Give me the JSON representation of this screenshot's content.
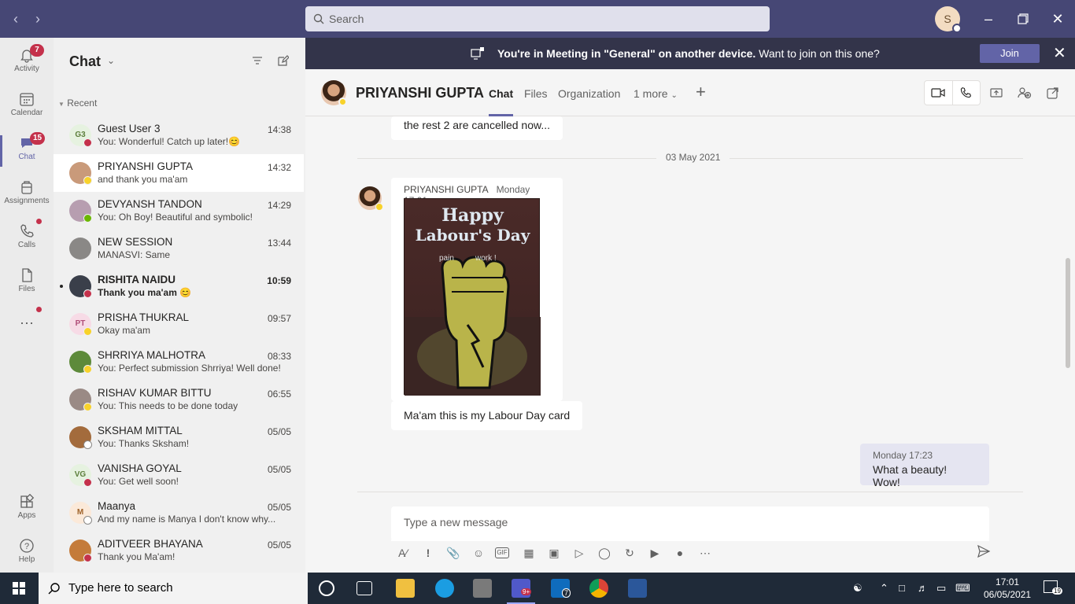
{
  "titlebar": {
    "search_placeholder": "Search",
    "me_initial": "S"
  },
  "rail": [
    {
      "label": "Activity",
      "badge": "7"
    },
    {
      "label": "Calendar"
    },
    {
      "label": "Chat",
      "badge": "15"
    },
    {
      "label": "Assignments"
    },
    {
      "label": "Calls"
    },
    {
      "label": "Files"
    },
    {
      "label": "Apps"
    },
    {
      "label": "Help"
    }
  ],
  "chatlist": {
    "title": "Chat",
    "section": "Recent",
    "items": [
      {
        "initials": "G3",
        "name": "Guest User 3",
        "preview": "You: Wonderful! Catch up later!😊",
        "time": "14:38",
        "avatar_bg": "#e6f2e0",
        "avatar_fg": "#5b7e3a",
        "status": "#c4314b"
      },
      {
        "initials": "",
        "name": "PRIYANSHI GUPTA",
        "preview": "and thank you ma'am",
        "time": "14:32",
        "avatar_bg": "#c99a7a",
        "avatar_fg": "#fff",
        "status": "#f8d22a"
      },
      {
        "initials": "",
        "name": "DEVYANSH TANDON",
        "preview": "You: Oh Boy! Beautiful and symbolic!",
        "time": "14:29",
        "avatar_bg": "#b79eb0",
        "avatar_fg": "#fff",
        "status": "#6bb700"
      },
      {
        "initials": "",
        "name": "NEW SESSION",
        "preview": "MANASVI: Same",
        "time": "13:44",
        "avatar_bg": "#8a8886",
        "avatar_fg": "#fff",
        "status": ""
      },
      {
        "initials": "",
        "name": "RISHITA NAIDU",
        "preview": "Thank you ma'am 😊",
        "time": "10:59",
        "avatar_bg": "#3a3f4a",
        "avatar_fg": "#fff",
        "status": "#c4314b"
      },
      {
        "initials": "PT",
        "name": "PRISHA THUKRAL",
        "preview": "Okay ma'am",
        "time": "09:57",
        "avatar_bg": "#f7dbe6",
        "avatar_fg": "#b04d78",
        "status": "#f8d22a"
      },
      {
        "initials": "",
        "name": "SHRRIYA MALHOTRA",
        "preview": "You: Perfect submission Shrriya! Well done!",
        "time": "08:33",
        "avatar_bg": "#5d8a3a",
        "avatar_fg": "#fff",
        "status": "#f8d22a"
      },
      {
        "initials": "",
        "name": "RISHAV KUMAR BITTU",
        "preview": "You: This needs to be done today",
        "time": "06:55",
        "avatar_bg": "#9a8a85",
        "avatar_fg": "#fff",
        "status": "#f8d22a"
      },
      {
        "initials": "",
        "name": "SKSHAM MITTAL",
        "preview": "You: Thanks Sksham!",
        "time": "05/05",
        "avatar_bg": "#a36b3c",
        "avatar_fg": "#fff",
        "status": "#ffffff"
      },
      {
        "initials": "VG",
        "name": "VANISHA GOYAL",
        "preview": "You: Get well soon!",
        "time": "05/05",
        "avatar_bg": "#e6f2e0",
        "avatar_fg": "#5b7e3a",
        "status": "#c4314b"
      },
      {
        "initials": "M",
        "name": "Maanya",
        "preview": "And my name is Manya I don't know why...",
        "time": "05/05",
        "avatar_bg": "#fbe9d9",
        "avatar_fg": "#a0632b",
        "status": "#ffffff"
      },
      {
        "initials": "",
        "name": "ADITVEER BHAYANA",
        "preview": "Thank you Ma'am!",
        "time": "05/05",
        "avatar_bg": "#c47b3a",
        "avatar_fg": "#fff",
        "status": "#c4314b"
      }
    ]
  },
  "banner": {
    "bold": "You're in Meeting in \"General\" on another device.",
    "rest": " Want to join on this one?",
    "join_label": "Join"
  },
  "conversation": {
    "name": "PRIYANSHI GUPTA",
    "tabs": [
      "Chat",
      "Files",
      "Organization",
      "1 more"
    ],
    "prev_message": "the rest 2 are cancelled now...",
    "date_sep": "03 May 2021",
    "sender": "PRIYANSHI GUPTA",
    "sender_time": "Monday 17:01",
    "card_text": [
      "Happy",
      "Labour's Day",
      "pain",
      "work !"
    ],
    "message": "Ma'am this is my Labour Day card",
    "reply_time": "Monday 17:23",
    "reply_text": "What a beauty! Wow!",
    "composer_placeholder": "Type a new message"
  },
  "taskbar": {
    "search_placeholder": "Type here to search",
    "teams_badge": "9+",
    "mail_badge": "7",
    "time": "17:01",
    "date": "06/05/2021",
    "notif": "19"
  }
}
